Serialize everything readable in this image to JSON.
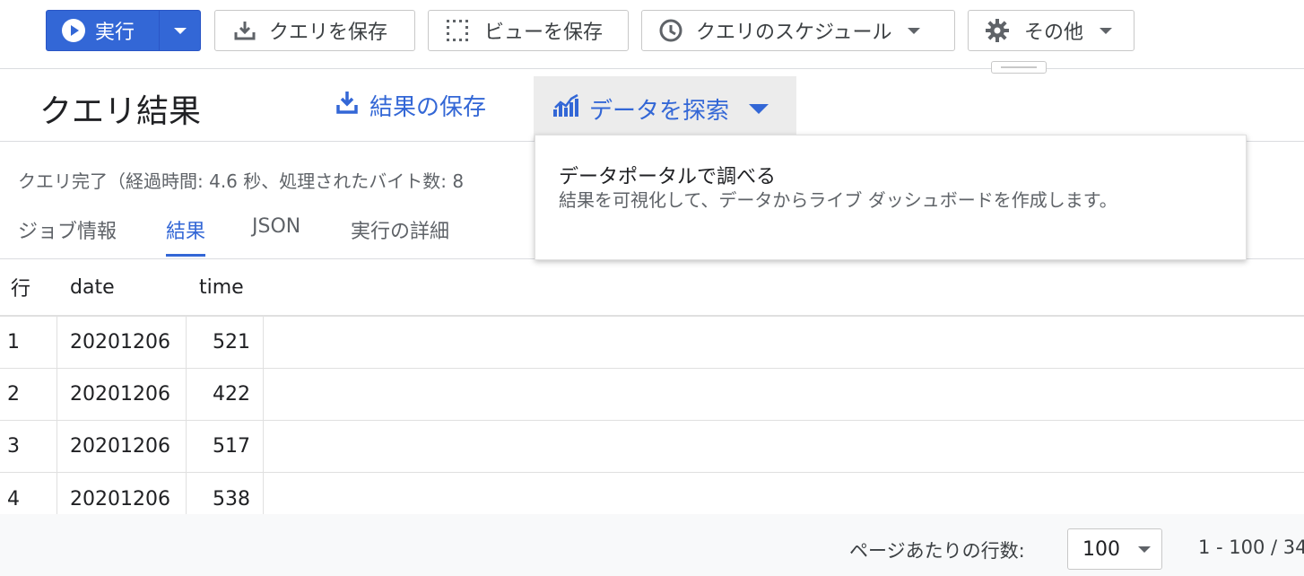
{
  "toolbar": {
    "run_label": "実行",
    "save_query_label": "クエリを保存",
    "save_view_label": "ビューを保存",
    "schedule_label": "クエリのスケジュール",
    "more_label": "その他"
  },
  "results": {
    "title": "クエリ結果",
    "save_results_label": "結果の保存",
    "explore_label": "データを探索",
    "status": "クエリ完了（経過時間: 4.6 秒、処理されたバイト数: 8"
  },
  "tabs": [
    "ジョブ情報",
    "結果",
    "JSON",
    "実行の詳細"
  ],
  "active_tab": "結果",
  "table": {
    "headers": [
      "行",
      "date",
      "time"
    ],
    "rows": [
      [
        "1",
        "20201206",
        "521"
      ],
      [
        "2",
        "20201206",
        "422"
      ],
      [
        "3",
        "20201206",
        "517"
      ],
      [
        "4",
        "20201206",
        "538"
      ]
    ]
  },
  "footer": {
    "rows_per_page_label": "ページあたりの行数:",
    "rows_per_page_value": "100",
    "pagination": "1 - 100 / 34"
  },
  "menu": {
    "item_title": "データポータルで調べる",
    "item_desc": "結果を可視化して、データからライブ ダッシュボードを作成します。"
  },
  "colors": {
    "accent": "#3367d6",
    "run_bg": "#3367d6"
  }
}
